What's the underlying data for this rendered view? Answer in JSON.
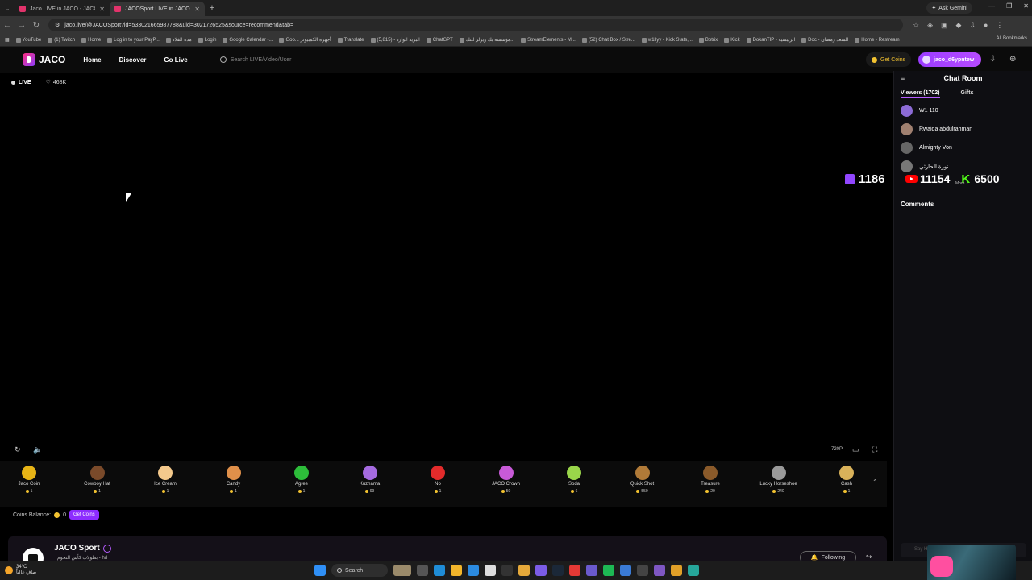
{
  "browser": {
    "tabs": [
      {
        "title": "Jaco LIVE in JACO - JACO",
        "active": false
      },
      {
        "title": "JACOSport LIVE in JACO - JACO",
        "active": true
      }
    ],
    "gemini": "Ask Gemini",
    "url": "jaco.live/@JACOSport?id=533021665987788&uid=3021726525&source=recommend&tab=",
    "bookmarks": [
      "YouTube",
      "(1) Twitch",
      "Home",
      "Log in to your PayP...",
      "مدة الفلاد",
      "Login",
      "Google Calendar -...",
      "Goo... أجهزة الكمبيوتر",
      "Translate",
      "(5,815) - البريد الوارد",
      "ChatGPT",
      "مؤسسة بك ويرلز للتك...",
      "StreamElements - M...",
      "(52) Chat Box / Stre...",
      "w1llyy - Kick Stats,...",
      "Botrix",
      "Kick",
      "DokanTIP - الرئيسية",
      "Doc - السعد رمضان",
      "Home - Restream"
    ],
    "all_bookmarks": "All Bookmarks"
  },
  "nav": {
    "logo": "JACO",
    "links": [
      "Home",
      "Discover",
      "Go Live"
    ],
    "search_placeholder": "Search LIVE/Video/User",
    "get_coins": "Get Coins",
    "username": "jaco_d6ypntew"
  },
  "video": {
    "live_label": "LIVE",
    "likes": "468K",
    "twitch_count": "1186",
    "resolution": "720P"
  },
  "gifts": [
    {
      "name": "Jaco Coin",
      "price": "1",
      "color": "#e7b416"
    },
    {
      "name": "Cowboy Hat",
      "price": "1",
      "color": "#7a4a2a"
    },
    {
      "name": "Ice Cream",
      "price": "1",
      "color": "#f4c98c"
    },
    {
      "name": "Candy",
      "price": "1",
      "color": "#e0904a"
    },
    {
      "name": "Agree",
      "price": "1",
      "color": "#2dbd3a"
    },
    {
      "name": "Kuzhama",
      "price": "99",
      "color": "#a56be0"
    },
    {
      "name": "No",
      "price": "1",
      "color": "#e32b2b"
    },
    {
      "name": "JACO Crown",
      "price": "50",
      "color": "#c85ad8"
    },
    {
      "name": "Soda",
      "price": "6",
      "color": "#9ad64a"
    },
    {
      "name": "Quick Shot",
      "price": "550",
      "color": "#b07a38"
    },
    {
      "name": "Treasure",
      "price": "20",
      "color": "#8a5a2a"
    },
    {
      "name": "Lucky Horseshoe",
      "price": "240",
      "color": "#9a9a9a"
    },
    {
      "name": "Cash",
      "price": "1",
      "color": "#d9b25a"
    }
  ],
  "balance": {
    "label": "Coins Balance:",
    "value": "0",
    "button": "Get Coins"
  },
  "channel": {
    "name": "JACO Sport",
    "subtitle": "بطولات كأس النجوم - hd",
    "following": "Following"
  },
  "chat": {
    "title": "Chat Room",
    "tabs": {
      "viewers": "Viewers (1702)",
      "gifts": "Gifts"
    },
    "viewers": [
      "W1 110",
      "Rwaida abdulrahman",
      "Almighty Von",
      "نورة الحارثي"
    ],
    "more": "More",
    "youtube_count": "11154",
    "kick_count": "6500",
    "comments": "Comments",
    "say_placeholder": "Say Hi"
  },
  "taskbar": {
    "temp": "34°C",
    "weather": "صافٍ غالباً",
    "search": "Search"
  }
}
